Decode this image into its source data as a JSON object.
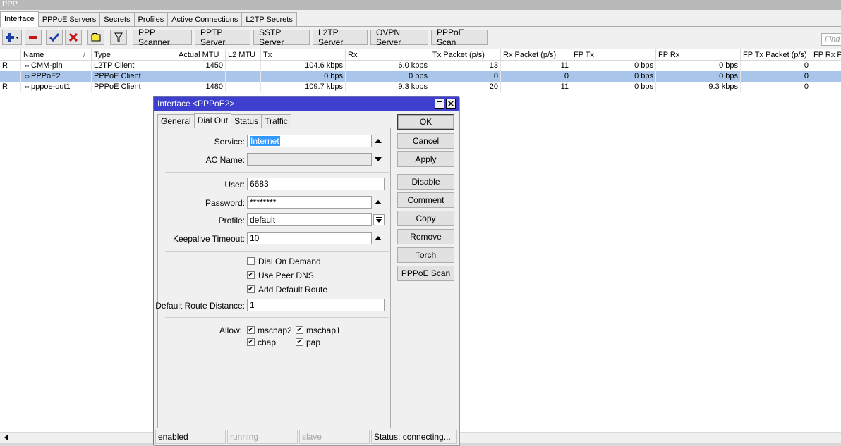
{
  "window": {
    "title": "PPP"
  },
  "tabs": [
    "Interface",
    "PPPoE Servers",
    "Secrets",
    "Profiles",
    "Active Connections",
    "L2TP Secrets"
  ],
  "toolbar": {
    "buttons": [
      "PPP Scanner",
      "PPTP Server",
      "SSTP Server",
      "L2TP Server",
      "OVPN Server",
      "PPPoE Scan"
    ],
    "find_placeholder": "Find"
  },
  "table": {
    "columns": [
      "Name",
      "Type",
      "Actual MTU",
      "L2 MTU",
      "Tx",
      "Rx",
      "Tx Packet (p/s)",
      "Rx Packet (p/s)",
      "FP Tx",
      "FP Rx",
      "FP Tx Packet (p/s)",
      "FP Rx Pa"
    ],
    "rows": [
      {
        "flag": "R",
        "name": "CMM-pin",
        "type": "L2TP Client",
        "actual_mtu": "1450",
        "l2_mtu": "",
        "tx": "104.6 kbps",
        "rx": "6.0 kbps",
        "tx_packet": "13",
        "rx_packet": "11",
        "fp_tx": "0 bps",
        "fp_rx": "0 bps",
        "fp_tx_packet": "0"
      },
      {
        "flag": "",
        "name": "PPPoE2",
        "type": "PPPoE Client",
        "actual_mtu": "",
        "l2_mtu": "",
        "tx": "0 bps",
        "rx": "0 bps",
        "tx_packet": "0",
        "rx_packet": "0",
        "fp_tx": "0 bps",
        "fp_rx": "0 bps",
        "fp_tx_packet": "0"
      },
      {
        "flag": "R",
        "name": "pppoe-out1",
        "type": "PPPoE Client",
        "actual_mtu": "1480",
        "l2_mtu": "",
        "tx": "109.7 kbps",
        "rx": "9.3 kbps",
        "tx_packet": "20",
        "rx_packet": "11",
        "fp_tx": "0 bps",
        "fp_rx": "9.3 kbps",
        "fp_tx_packet": "0"
      }
    ],
    "selected_row": 1
  },
  "dialog": {
    "title": "Interface <PPPoE2>",
    "tabs": [
      "General",
      "Dial Out",
      "Status",
      "Traffic"
    ],
    "active_tab": "Dial Out",
    "fields": {
      "service_label": "Service:",
      "service_value": "Internet",
      "ac_name_label": "AC Name:",
      "ac_name_value": "",
      "user_label": "User:",
      "user_value": "6683",
      "password_label": "Password:",
      "password_value": "********",
      "profile_label": "Profile:",
      "profile_value": "default",
      "keepalive_label": "Keepalive Timeout:",
      "keepalive_value": "10",
      "dial_on_demand_label": "Dial On Demand",
      "dial_on_demand": false,
      "use_peer_dns_label": "Use Peer DNS",
      "use_peer_dns": true,
      "add_default_route_label": "Add Default Route",
      "add_default_route": true,
      "default_route_distance_label": "Default Route Distance:",
      "default_route_distance_value": "1",
      "allow_label": "Allow:",
      "allow": {
        "mschap2": "mschap2",
        "mschap1": "mschap1",
        "chap": "chap",
        "pap": "pap"
      }
    },
    "buttons": [
      "OK",
      "Cancel",
      "Apply",
      "Disable",
      "Comment",
      "Copy",
      "Remove",
      "Torch",
      "PPPoE Scan"
    ],
    "status_bar": [
      "enabled",
      "running",
      "slave",
      "Status: connecting..."
    ]
  }
}
